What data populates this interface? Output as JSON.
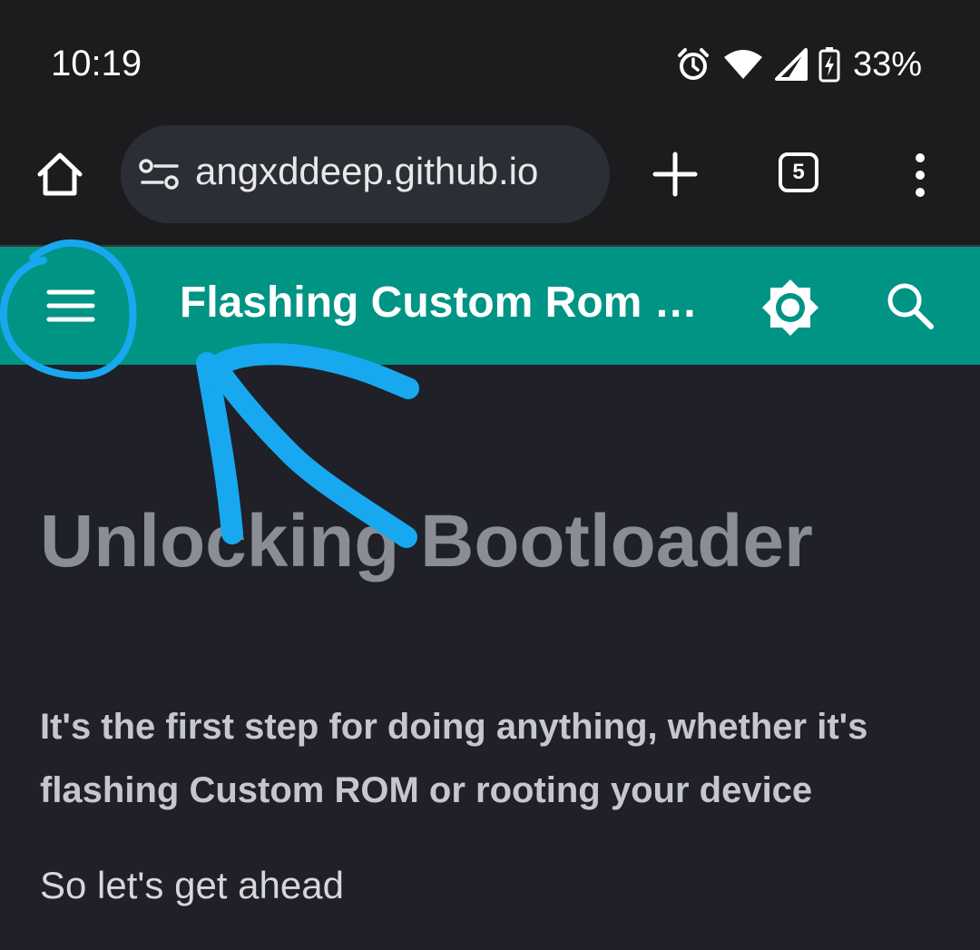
{
  "status_bar": {
    "time": "10:19",
    "battery": "33%",
    "icons": [
      "alarm-icon",
      "wifi-icon",
      "cellular-signal-icon",
      "battery-charging-icon"
    ]
  },
  "browser": {
    "url": "angxddeep.github.io",
    "tab_count": "5",
    "icons": [
      "home-icon",
      "site-settings-icon",
      "new-tab-icon",
      "tab-switcher-icon",
      "more-menu-icon"
    ]
  },
  "site_header": {
    "title": "Flashing Custom Rom G...",
    "icons": [
      "menu-icon",
      "brightness-icon",
      "search-icon"
    ],
    "background": "#009485"
  },
  "content": {
    "heading": "Unlocking Bootloader",
    "intro": "It's the first step for doing anything, whether it's flashing Custom ROM or rooting your device",
    "lead": "So let's get ahead"
  },
  "annotation": {
    "color": "#18a8f0",
    "shapes": [
      "circle-around-menu",
      "arrow-pointing-to-menu"
    ]
  }
}
